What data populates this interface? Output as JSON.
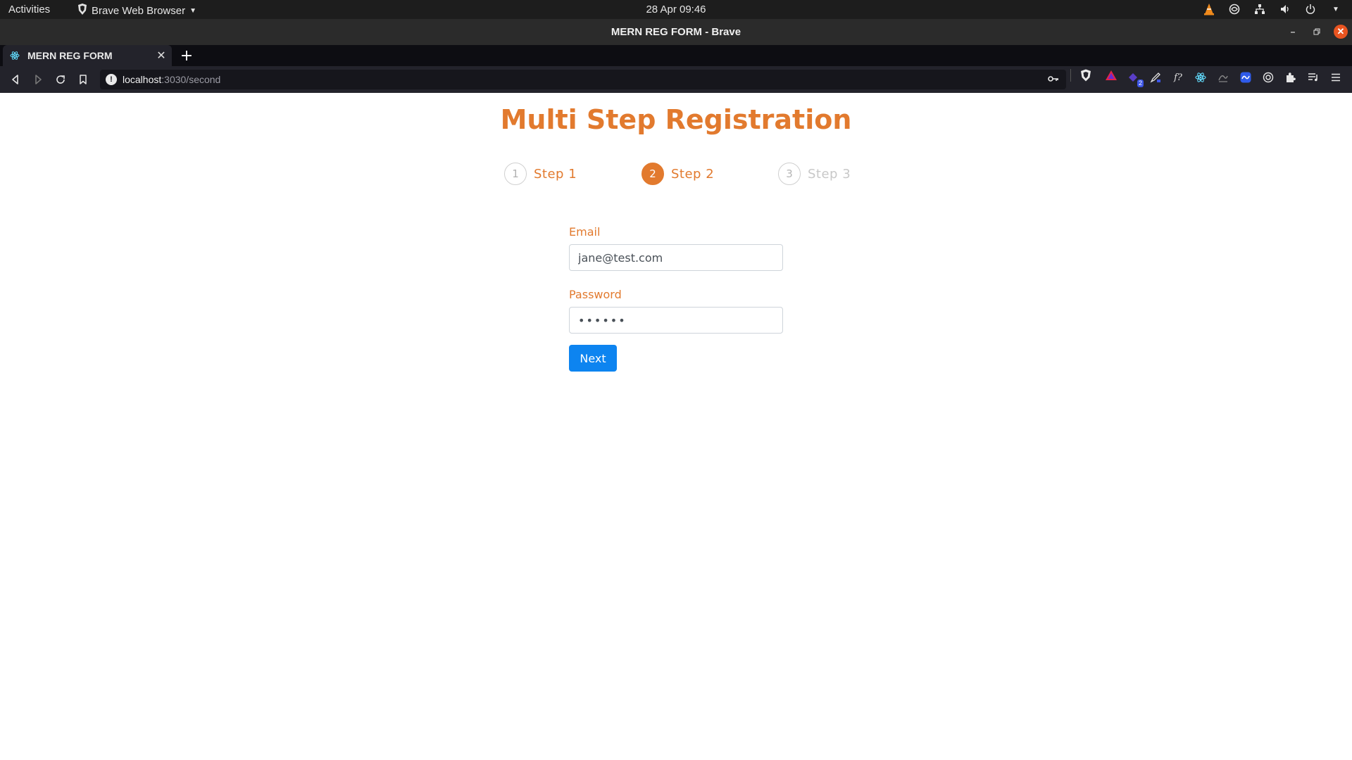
{
  "system": {
    "activities_label": "Activities",
    "app_menu_label": "Brave Web Browser",
    "clock": "28 Apr  09:46"
  },
  "window": {
    "title": "MERN REG FORM - Brave"
  },
  "tabs": [
    {
      "title": "MERN REG FORM"
    }
  ],
  "address_bar": {
    "host": "localhost",
    "path": ":3030/second"
  },
  "extensions": {
    "badge_1": "2"
  },
  "page": {
    "title": "Multi Step Registration",
    "steps": [
      {
        "number": "1",
        "label": "Step 1",
        "state": "done"
      },
      {
        "number": "2",
        "label": "Step 2",
        "state": "active"
      },
      {
        "number": "3",
        "label": "Step 3",
        "state": "todo"
      }
    ],
    "form": {
      "email_label": "Email",
      "email_value": "jane@test.com",
      "password_label": "Password",
      "password_value": "••••••",
      "next_label": "Next"
    }
  },
  "colors": {
    "accent": "#e27a2e",
    "button": "#0d84f0"
  }
}
